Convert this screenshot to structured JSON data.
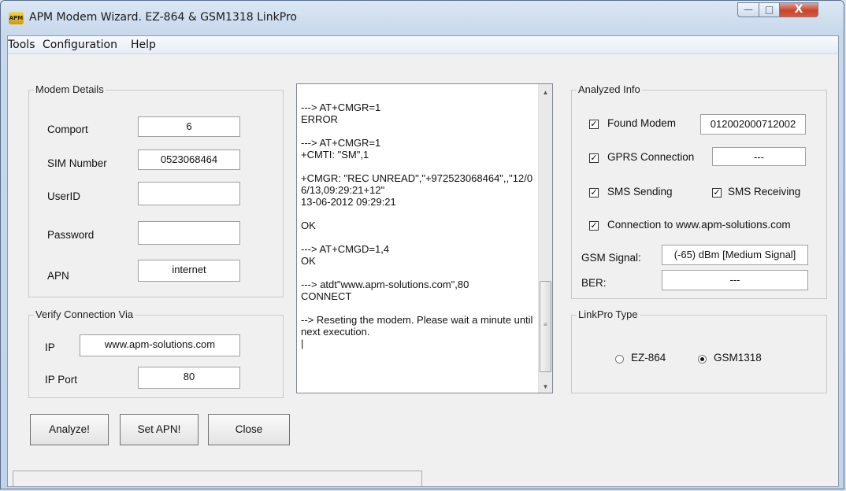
{
  "window": {
    "title": "APM Modem Wizard. EZ-864 & GSM1318 LinkPro",
    "app_icon_text": "APM",
    "minimize_glyph": "—",
    "maximize_glyph": "□",
    "close_glyph": "X"
  },
  "menu": [
    "Tools",
    "Configuration",
    "Help"
  ],
  "modem_details": {
    "legend": "Modem Details",
    "comport_label": "Comport",
    "comport_value": "6",
    "sim_label": "SIM Number",
    "sim_value": "0523068464",
    "userid_label": "UserID",
    "userid_value": "",
    "password_label": "Password",
    "password_value": "",
    "apn_label": "APN",
    "apn_value": "internet"
  },
  "verify": {
    "legend": "Verify Connection Via",
    "ip_label": "IP",
    "ip_value": "www.apm-solutions.com",
    "port_label": "IP Port",
    "port_value": "80"
  },
  "buttons": {
    "analyze": "Analyze!",
    "set_apn": "Set APN!",
    "close": "Close"
  },
  "log": {
    "text": "---> AT+CMGR=1\nERROR\n\n---> AT+CMGR=1\n+CMTI: \"SM\",1\n\n+CMGR: \"REC UNREAD\",\"+972523068464\",,\"12/06/13,09:29:21+12\"\n13-06-2012 09:29:21\n\nOK\n\n---> AT+CMGD=1,4\nOK\n\n---> atdt\"www.apm-solutions.com\",80\nCONNECT\n\n--> Reseting the modem. Please wait a minute until next execution.\n|"
  },
  "analyzed": {
    "legend": "Analyzed Info",
    "found_modem": {
      "label": "Found Modem",
      "checked": true,
      "value": "012002000712002"
    },
    "gprs": {
      "label": "GPRS Connection",
      "checked": true,
      "value": "---"
    },
    "sms_sending": {
      "label": "SMS Sending",
      "checked": true
    },
    "sms_receiving": {
      "label": "SMS Receiving",
      "checked": true
    },
    "connection": {
      "label": "Connection to www.apm-solutions.com",
      "checked": true
    },
    "gsm_signal_label": "GSM Signal:",
    "gsm_signal_value": "(-65) dBm [Medium Signal]",
    "ber_label": "BER:",
    "ber_value": "---",
    "check_glyph": "✓"
  },
  "linkpro": {
    "legend": "LinkPro Type",
    "options": [
      {
        "label": "EZ-864",
        "selected": false
      },
      {
        "label": "GSM1318",
        "selected": true
      }
    ]
  },
  "scrollbar": {
    "up": "▲",
    "down": "▼",
    "grip": "≡"
  }
}
